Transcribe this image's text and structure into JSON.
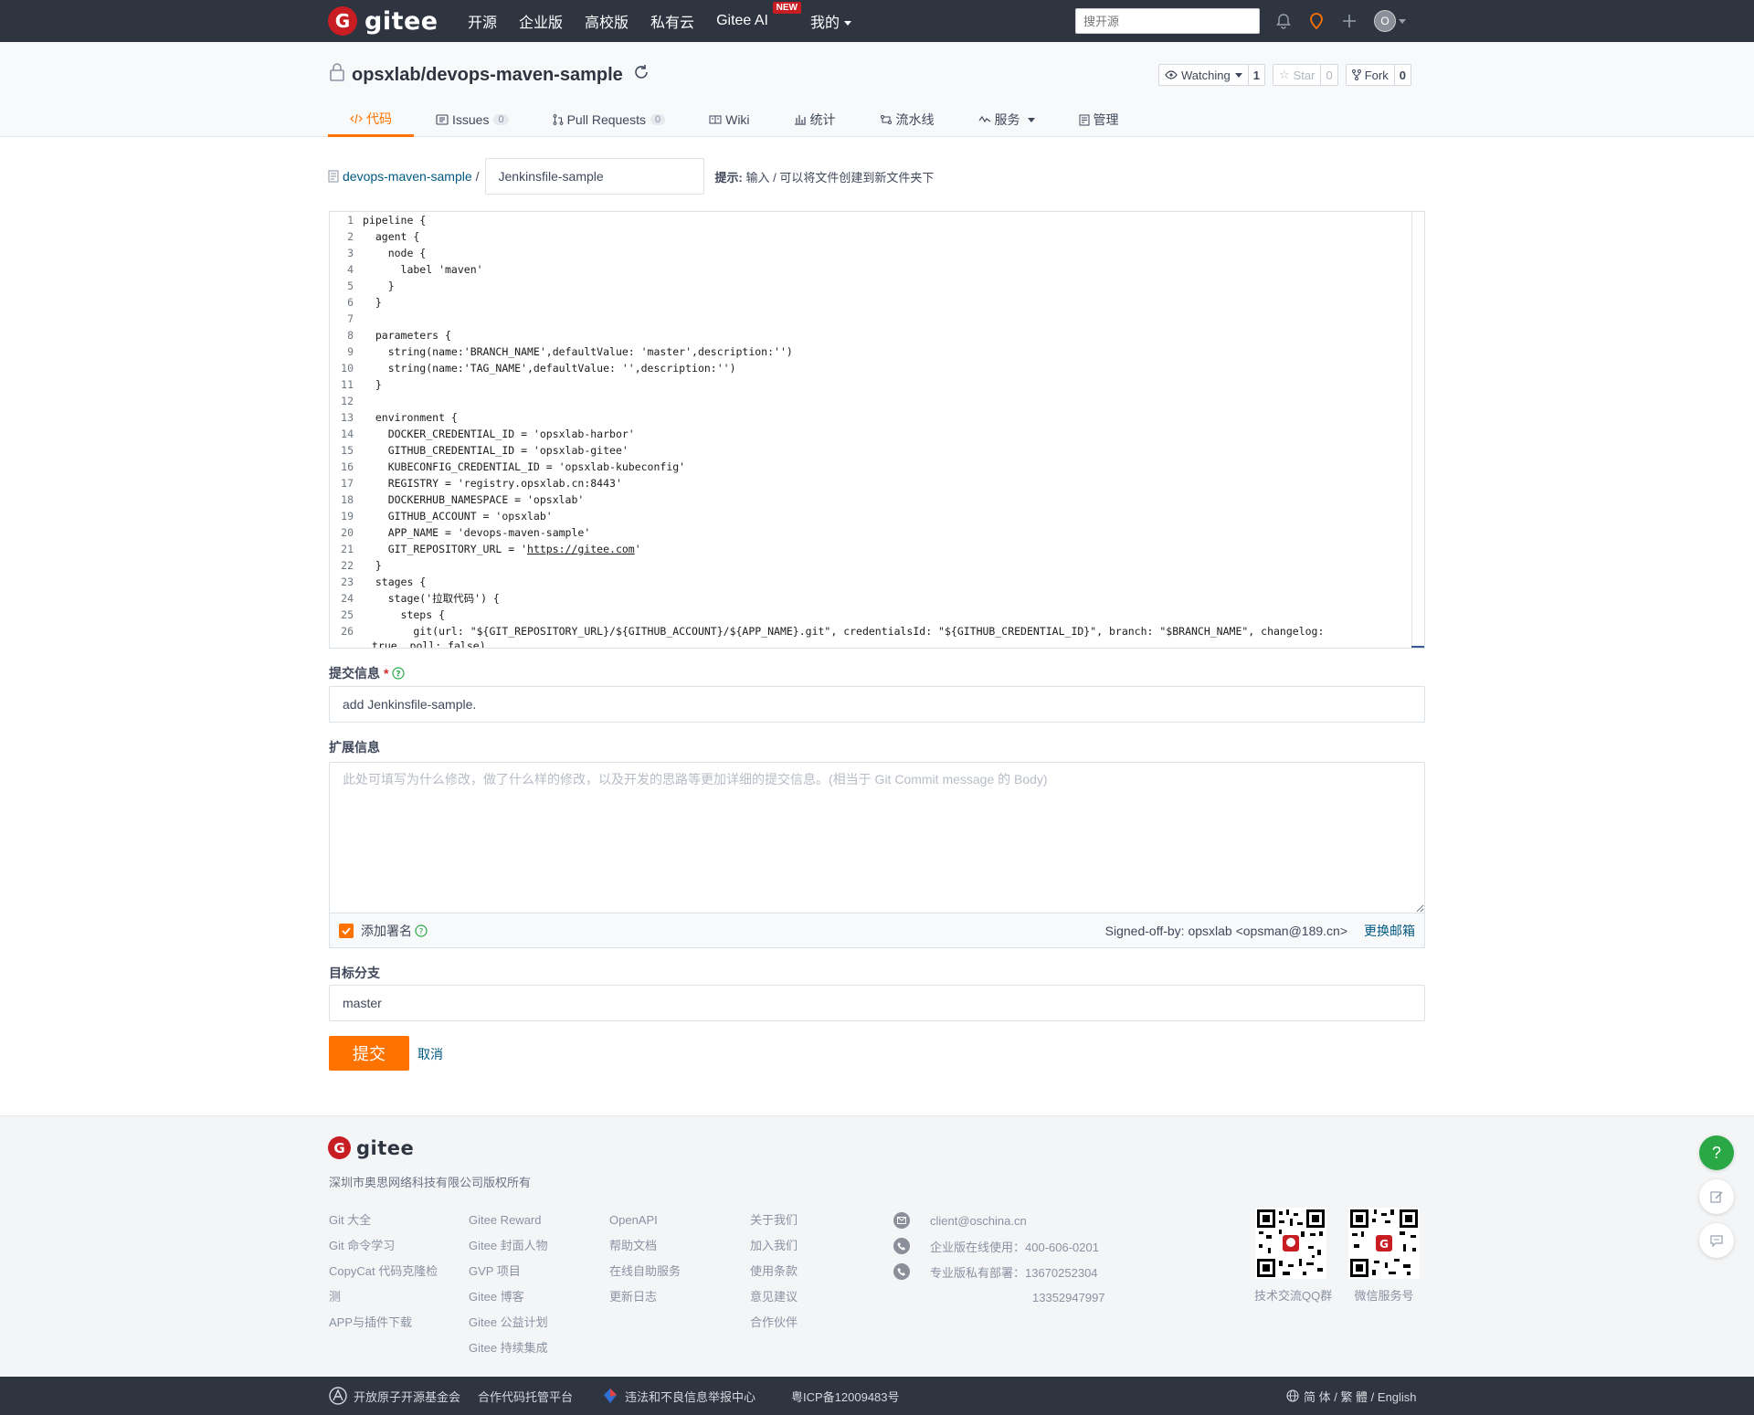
{
  "colors": {
    "accent": "#fe7300",
    "brand_red": "#c71d23",
    "link": "#005980",
    "nav_bg": "#2e3440"
  },
  "nav": {
    "logo": "gitee",
    "links": [
      "开源",
      "企业版",
      "高校版",
      "私有云",
      "Gitee AI",
      "我的"
    ],
    "new_badge": "NEW",
    "search_placeholder": "搜开源",
    "avatar_letter": "O"
  },
  "repo": {
    "title": "opsxlab/devops-maven-sample",
    "watch_label": "Watching",
    "watch_count": "1",
    "star_label": "Star",
    "star_count": "0",
    "fork_label": "Fork",
    "fork_count": "0"
  },
  "tabs": [
    {
      "label": "代码",
      "icon": "code-icon"
    },
    {
      "label": "Issues",
      "count": "0",
      "icon": "issues-icon"
    },
    {
      "label": "Pull Requests",
      "count": "0",
      "icon": "pull-request-icon"
    },
    {
      "label": "Wiki",
      "icon": "wiki-icon"
    },
    {
      "label": "统计",
      "icon": "stats-icon"
    },
    {
      "label": "流水线",
      "icon": "pipeline-icon"
    },
    {
      "label": "服务",
      "icon": "service-icon"
    },
    {
      "label": "管理",
      "icon": "manage-icon"
    }
  ],
  "breadcrumb": {
    "repo_link": "devops-maven-sample",
    "separator": "/",
    "filename": "Jenkinsfile-sample",
    "hint_label": "提示:",
    "hint_text": "输入 / 可以将文件创建到新文件夹下"
  },
  "editor": {
    "lines": [
      "pipeline {",
      "  agent {",
      "    node {",
      "      label 'maven'",
      "    }",
      "  }",
      "",
      "  parameters {",
      "    string(name:'BRANCH_NAME',defaultValue: 'master',description:'')",
      "    string(name:'TAG_NAME',defaultValue: '',description:'')",
      "  }",
      "",
      "  environment {",
      "    DOCKER_CREDENTIAL_ID = 'opsxlab-harbor'",
      "    GITHUB_CREDENTIAL_ID = 'opsxlab-gitee'",
      "    KUBECONFIG_CREDENTIAL_ID = 'opsxlab-kubeconfig'",
      "    REGISTRY = 'registry.opsxlab.cn:8443'",
      "    DOCKERHUB_NAMESPACE = 'opsxlab'",
      "    GITHUB_ACCOUNT = 'opsxlab'",
      "    APP_NAME = 'devops-maven-sample'",
      "    GIT_REPOSITORY_URL = 'https://gitee.com'",
      "  }",
      "  stages {",
      "    stage('拉取代码') {",
      "      steps {",
      "        git(url: \"${GIT_REPOSITORY_URL}/${GITHUB_ACCOUNT}/${APP_NAME}.git\", credentialsId: \"${GITHUB_CREDENTIAL_ID}\", branch: \"$BRANCH_NAME\", changelog:"
    ],
    "wrap_line": "true, poll: false)"
  },
  "form": {
    "commit_label": "提交信息",
    "commit_required": "*",
    "commit_value": "add Jenkinsfile-sample.",
    "ext_label": "扩展信息",
    "ext_placeholder": "此处可填写为什么修改，做了什么样的修改，以及开发的思路等更加详细的提交信息。(相当于 Git Commit message 的 Body)",
    "sign_label": "添加署名",
    "sign_text": "Signed-off-by: opsxlab <opsman@189.cn>",
    "change_mail": "更换邮箱",
    "branch_label": "目标分支",
    "branch_value": "master",
    "submit": "提交",
    "cancel": "取消"
  },
  "footer": {
    "logo": "gitee",
    "copyright": "深圳市奥思网络科技有限公司版权所有",
    "col1": [
      "Git 大全",
      "Git 命令学习",
      "CopyCat 代码克隆检测",
      "APP与插件下载"
    ],
    "col2": [
      "Gitee Reward",
      "Gitee 封面人物",
      "GVP 项目",
      "Gitee 博客",
      "Gitee 公益计划",
      "Gitee 持续集成"
    ],
    "col3": [
      "OpenAPI",
      "帮助文档",
      "在线自助服务",
      "更新日志"
    ],
    "col4": [
      "关于我们",
      "加入我们",
      "使用条款",
      "意见建议",
      "合作伙伴"
    ],
    "email": "client@oschina.cn",
    "phone1": "企业版在线使用：400-606-0201",
    "phone2": "专业版私有部署：13670252304",
    "phone3": "13352947997",
    "qr1_caption": "技术交流QQ群",
    "qr2_caption": "微信服务号"
  },
  "bottom": {
    "item1": "开放原子开源基金会",
    "item2": "合作代码托管平台",
    "item3": "违法和不良信息举报中心",
    "item4": "粤ICP备12009483号",
    "lang": "简 体 / 繁 體 / English"
  }
}
